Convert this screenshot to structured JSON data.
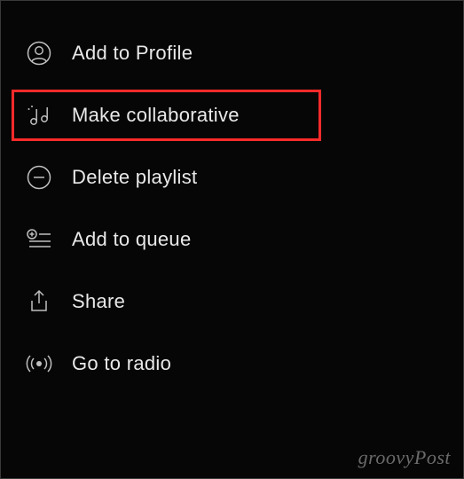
{
  "menu": {
    "items": [
      {
        "label": "Add to Profile",
        "icon": "person-icon",
        "highlighted": false
      },
      {
        "label": "Make collaborative",
        "icon": "music-note-icon",
        "highlighted": true
      },
      {
        "label": "Delete playlist",
        "icon": "minus-circle-icon",
        "highlighted": false
      },
      {
        "label": "Add to queue",
        "icon": "queue-add-icon",
        "highlighted": false
      },
      {
        "label": "Share",
        "icon": "share-icon",
        "highlighted": false
      },
      {
        "label": "Go to radio",
        "icon": "radio-icon",
        "highlighted": false
      }
    ]
  },
  "watermark": "groovyPost"
}
